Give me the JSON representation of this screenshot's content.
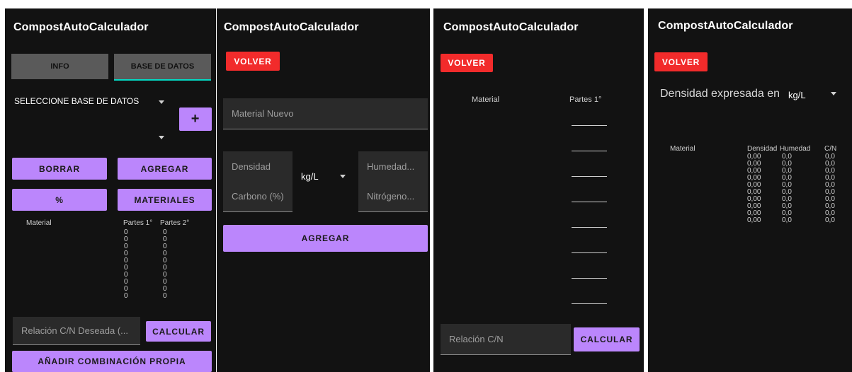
{
  "app_title": "CompostAutoCalculador",
  "screen1": {
    "tabs": [
      "INFO",
      "BASE DE DATOS"
    ],
    "db_spinner": "SELECCIONE BASE DE DATOS",
    "add_icon": "+",
    "borrar": "BORRAR",
    "agregar": "AGREGAR",
    "percent": "%",
    "materiales": "MATERIALES",
    "headers": {
      "material": "Material",
      "partes1": "Partes 1°",
      "partes2": "Partes 2°"
    },
    "partes1_values": [
      "0",
      "0",
      "0",
      "0",
      "0",
      "0",
      "0",
      "0",
      "0",
      "0"
    ],
    "partes2_values": [
      "0",
      "0",
      "0",
      "0",
      "0",
      "0",
      "0",
      "0",
      "0",
      "0"
    ],
    "cn_placeholder": "Relación C/N Deseada (...",
    "calcular": "CALCULAR",
    "anadir": "AÑADIR COMBINACIÓN PROPIA"
  },
  "screen2": {
    "volver": "VOLVER",
    "material_nuevo": "Material Nuevo",
    "densidad": "Densidad",
    "unit": "kg/L",
    "humedad": "Humedad...",
    "carbono": "Carbono (%)",
    "nitrogeno": "Nitrógeno...",
    "agregar": "AGREGAR"
  },
  "screen3": {
    "volver": "VOLVER",
    "header_material": "Material",
    "header_partes": "Partes 1°",
    "cn_placeholder": "Relación C/N",
    "calcular": "CALCULAR"
  },
  "screen4": {
    "volver": "VOLVER",
    "density_label": "Densidad expresada en",
    "unit": "kg/L",
    "headers": {
      "material": "Material",
      "densidad": "Densidad",
      "humedad": "Humedad",
      "cn": "C/N"
    },
    "densidad_values": [
      "0,00",
      "0,00",
      "0,00",
      "0,00",
      "0,00",
      "0,00",
      "0,00",
      "0,00",
      "0,00",
      "0,00"
    ],
    "humedad_values": [
      "0,0",
      "0,0",
      "0,0",
      "0,0",
      "0,0",
      "0,0",
      "0,0",
      "0,0",
      "0,0",
      "0,0"
    ],
    "cn_values": [
      "0,0",
      "0,0",
      "0,0",
      "0,0",
      "0,0",
      "0,0",
      "0,0",
      "0,0",
      "0,0",
      "0,0"
    ]
  },
  "colors": {
    "purple": "#bb86fc",
    "red": "#f22b2b",
    "teal": "#03dac5",
    "background": "#121212"
  },
  "icons": [
    "caret-down-icon",
    "plus-icon"
  ]
}
